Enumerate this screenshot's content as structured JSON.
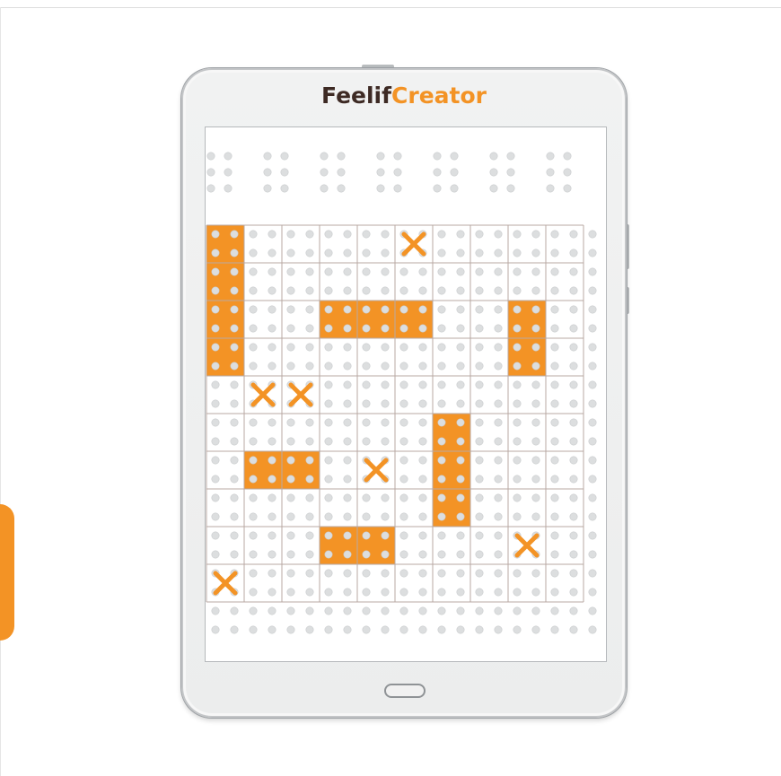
{
  "brand": {
    "part1": "Feelif",
    "part2": "Creator",
    "color_dark": "#3d2a24",
    "color_accent": "#f39325"
  },
  "device": {
    "type": "tablet",
    "home_button_icon": "home-button-icon"
  },
  "braille_header": {
    "cells": 7,
    "description_icon": "braille-dots-icon"
  },
  "grid": {
    "columns": 10,
    "rows": 10,
    "fill_color": "#f39325",
    "empty_color": "#ffffff",
    "filled_cells": [
      [
        0,
        0
      ],
      [
        1,
        0
      ],
      [
        2,
        0
      ],
      [
        3,
        0
      ],
      [
        2,
        3
      ],
      [
        2,
        4
      ],
      [
        2,
        5
      ],
      [
        2,
        8
      ],
      [
        3,
        8
      ],
      [
        5,
        6
      ],
      [
        6,
        6
      ],
      [
        7,
        6
      ],
      [
        6,
        1
      ],
      [
        6,
        2
      ],
      [
        8,
        3
      ],
      [
        8,
        4
      ]
    ],
    "marked_cells": [
      [
        0,
        5
      ],
      [
        4,
        1
      ],
      [
        4,
        2
      ],
      [
        6,
        4
      ],
      [
        8,
        8
      ],
      [
        9,
        0
      ]
    ],
    "marker_icon": "x-mark-icon"
  },
  "side_tab_color": "#f39325"
}
